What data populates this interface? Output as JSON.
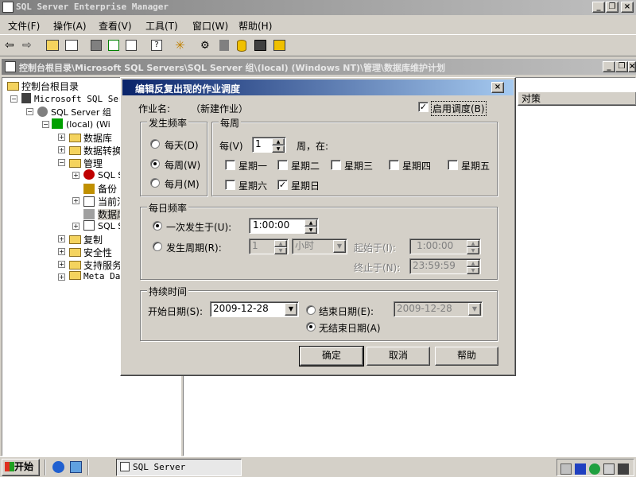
{
  "app": {
    "title": "SQL Server Enterprise Manager",
    "menu": [
      "文件(F)",
      "操作(A)",
      "查看(V)",
      "工具(T)",
      "窗口(W)",
      "帮助(H)"
    ]
  },
  "child_window": {
    "title": "控制台根目录\\Microsoft SQL Servers\\SQL Server 组\\(local) (Windows NT)\\管理\\数据库维护计划"
  },
  "tree": {
    "items": [
      "控制台根目录",
      "Microsoft SQL Servers",
      "SQL Server 组",
      "(local) (Wi",
      "数据库",
      "数据转换",
      "管理",
      "SQL S",
      "备份",
      "当前活",
      "数据库",
      "SQL S",
      "复制",
      "安全性",
      "支持服务",
      "Meta Dat"
    ]
  },
  "right_pane": {
    "column_header": "对策"
  },
  "dialog": {
    "title": "编辑反复出现的作业调度",
    "job_name_label": "作业名:",
    "job_name_value": "（新建作业）",
    "enable_label": "启用调度(B)",
    "enable_checked": true,
    "frequency": {
      "title": "发生频率",
      "options": [
        "每天(D)",
        "每周(W)",
        "每月(M)"
      ],
      "selected": "每周(W)"
    },
    "weekly": {
      "title": "每周",
      "every_label": "每(V)",
      "every_value": "1",
      "every_suffix": "周，在:",
      "days": [
        "星期一",
        "星期二",
        "星期三",
        "星期四",
        "星期五",
        "星期六",
        "星期日"
      ],
      "checked_days": [
        "星期日"
      ]
    },
    "daily": {
      "title": "每日频率",
      "once_label": "一次发生于(U):",
      "once_value": "1:00:00",
      "every_label": "发生周期(R):",
      "every_value": "1",
      "every_unit": "小时",
      "start_label": "起始于(I):",
      "start_value": "1:00:00",
      "end_label": "终止于(N):",
      "end_value": "23:59:59"
    },
    "duration": {
      "title": "持续时间",
      "start_label": "开始日期(S):",
      "start_value": "2009-12-28",
      "end_label": "结束日期(E):",
      "end_value": "2009-12-28",
      "no_end_label": "无结束日期(A)",
      "selected": "无结束日期(A)"
    },
    "buttons": {
      "ok": "确定",
      "cancel": "取消",
      "help": "帮助"
    }
  },
  "taskbar": {
    "start_label": "开始",
    "task_label": "SQL Server Enterpri..."
  },
  "colors": {
    "title_active_start": "#0a246a",
    "title_active_end": "#a6caf0",
    "title_inactive_start": "#808080",
    "title_inactive_end": "#c0c0c0",
    "face": "#d4d0c8"
  }
}
